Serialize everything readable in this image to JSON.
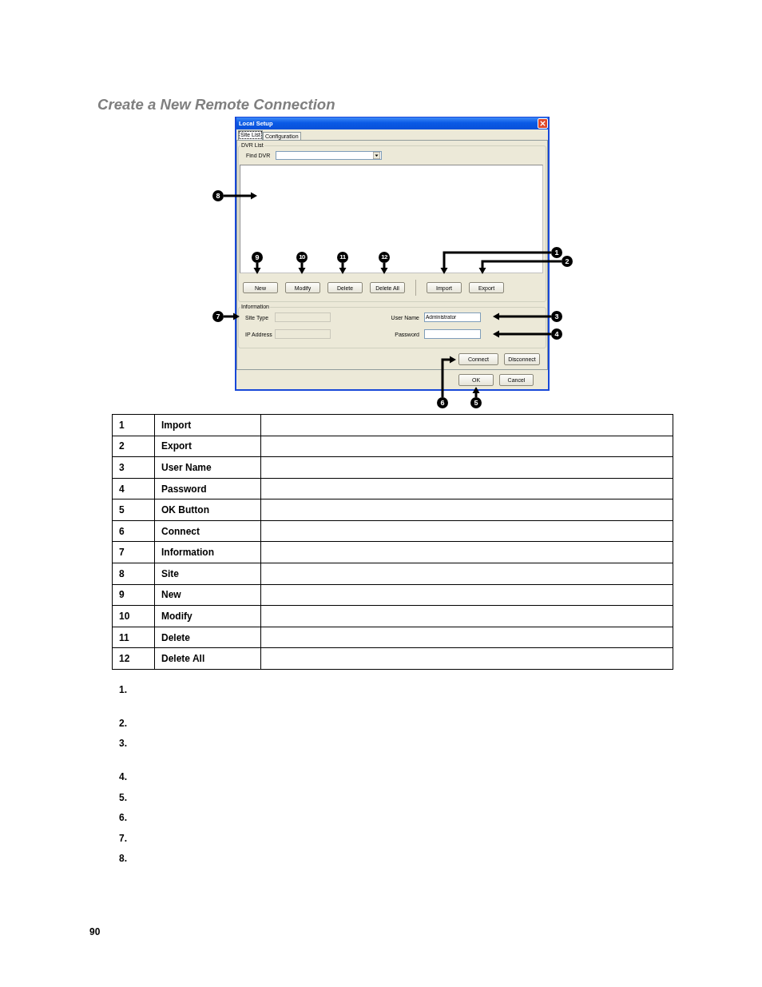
{
  "heading": "Create a New Remote Connection",
  "dialog": {
    "title": "Local Setup",
    "tabs": [
      {
        "label": "Site List",
        "selected": true
      },
      {
        "label": "Configuration",
        "selected": false
      }
    ],
    "dvr_list": {
      "legend": "DVR List",
      "find_label": "Find DVR",
      "site_buttons": [
        "New",
        "Modify",
        "Delete",
        "Delete All"
      ],
      "file_buttons": [
        "Import",
        "Export"
      ]
    },
    "information": {
      "legend": "Information",
      "fields": [
        {
          "label": "Site Type",
          "disabled": true
        },
        {
          "label": "User Name",
          "value": "Administrator",
          "disabled": false
        },
        {
          "label": "IP Address",
          "disabled": true
        },
        {
          "label": "Password",
          "disabled": false
        }
      ]
    },
    "connection_buttons": [
      "Connect",
      "Disconnect"
    ],
    "footer_buttons": [
      "OK",
      "Cancel"
    ]
  },
  "callouts": [
    "8",
    "9",
    "10",
    "11",
    "12",
    "1",
    "2",
    "7",
    "3",
    "4",
    "6",
    "5"
  ],
  "table": {
    "rows": [
      {
        "number": "1",
        "label": "Import"
      },
      {
        "number": "2",
        "label": "Export"
      },
      {
        "number": "3",
        "label": "User Name"
      },
      {
        "number": "4",
        "label": "Password"
      },
      {
        "number": "5",
        "label": "OK Button"
      },
      {
        "number": "6",
        "label": "Connect"
      },
      {
        "number": "7",
        "label": "Information"
      },
      {
        "number": "8",
        "label": "Site"
      },
      {
        "number": "9",
        "label": "New"
      },
      {
        "number": "10",
        "label": "Modify"
      },
      {
        "number": "11",
        "label": "Delete"
      },
      {
        "number": "12",
        "label": "Delete All"
      }
    ]
  },
  "numbered_list": [
    "1.",
    "2.",
    "3.",
    "4.",
    "5.",
    "6.",
    "7.",
    "8."
  ],
  "page_number": "90"
}
